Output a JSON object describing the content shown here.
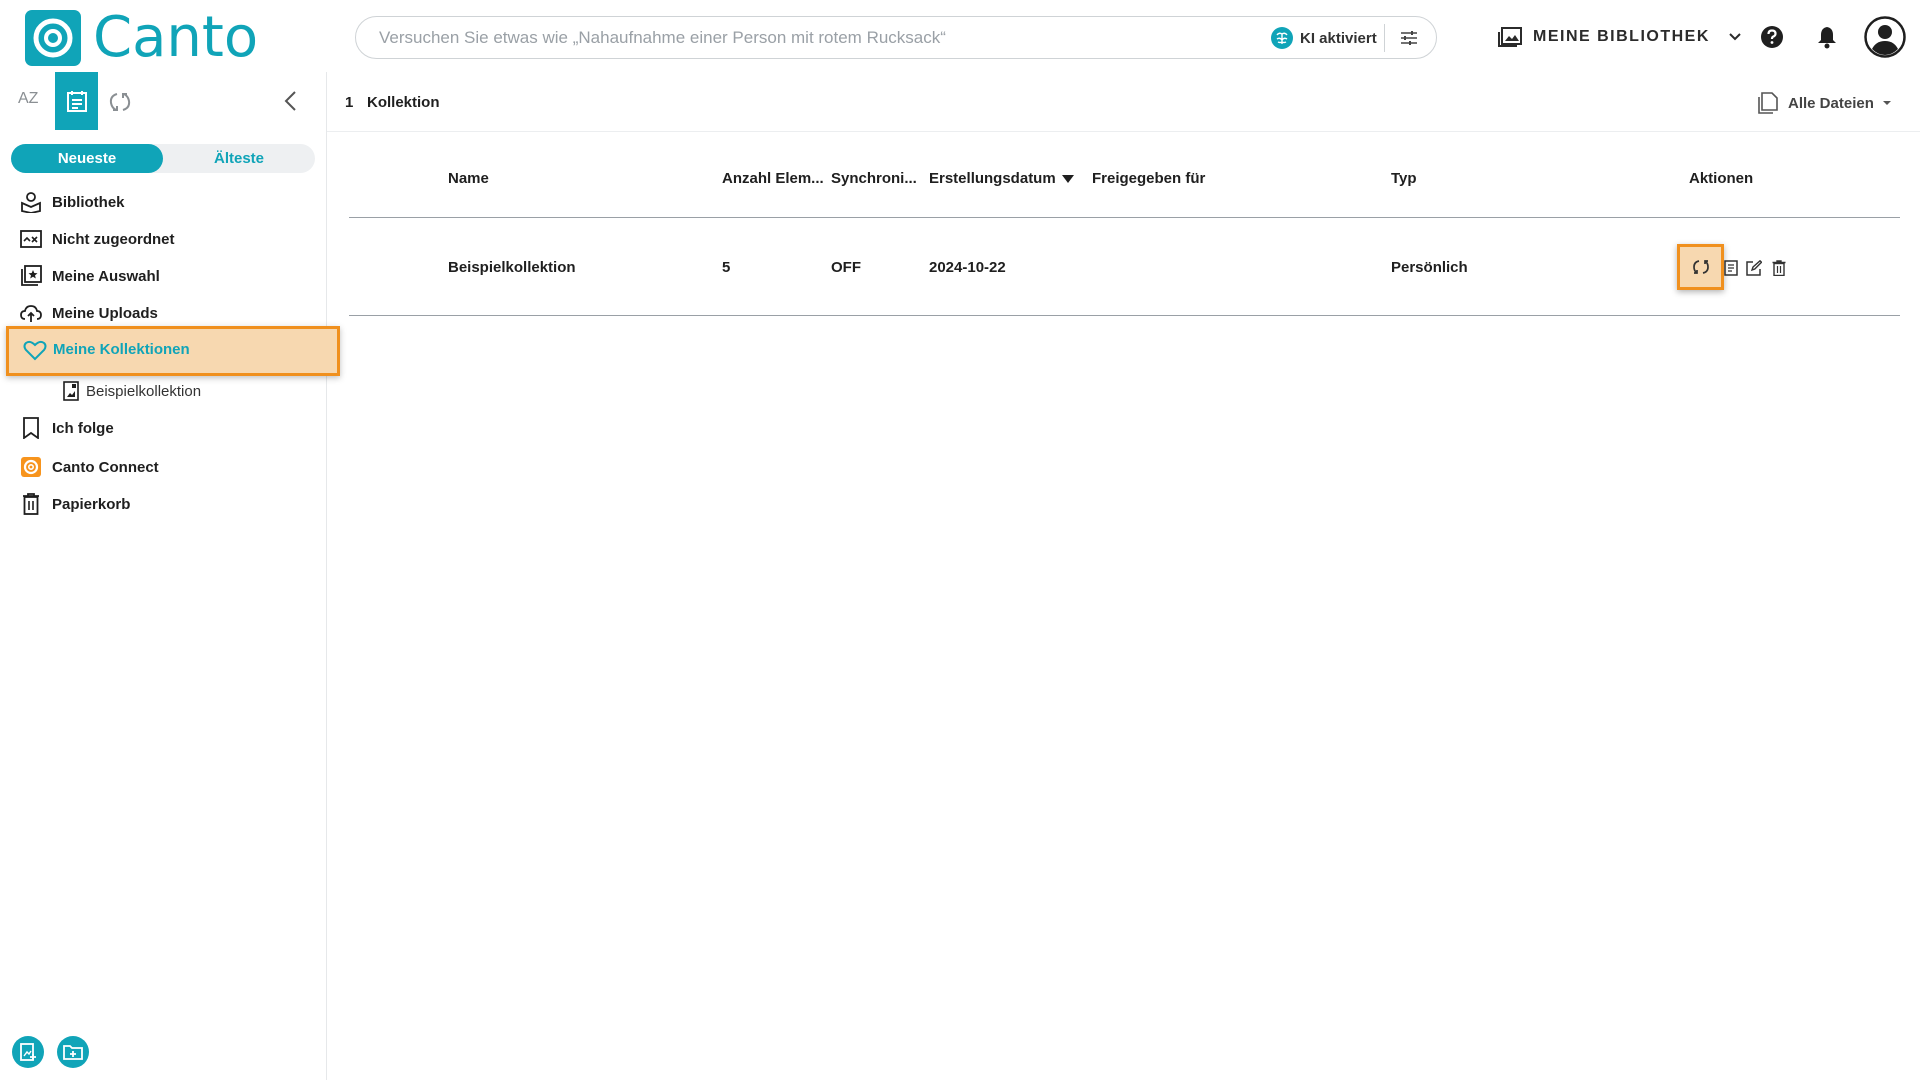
{
  "header": {
    "logo_text": "Canto",
    "search_placeholder": "Versuchen Sie etwas wie „Nahaufnahme einer Person mit rotem Rucksack“",
    "ai_label": "KI aktiviert",
    "library_label": "MEINE BIBLIOTHEK",
    "icons": [
      "brain-icon",
      "filter-sliders-icon",
      "library-icon",
      "chevron-down-icon",
      "help-icon",
      "bell-icon",
      "user-avatar-icon"
    ]
  },
  "sidebar": {
    "tab_az": "AZ",
    "sort": {
      "newest": "Neueste",
      "oldest": "Älteste"
    },
    "items": [
      {
        "label": "Bibliothek",
        "icon": "library-person-icon"
      },
      {
        "label": "Nicht zugeordnet",
        "icon": "unassigned-icon"
      },
      {
        "label": "Meine Auswahl",
        "icon": "selection-star-icon"
      },
      {
        "label": "Meine Uploads",
        "icon": "upload-icon"
      },
      {
        "label": "Meine Kollektionen",
        "icon": "heart-icon",
        "active": true
      },
      {
        "label": "Ich folge",
        "icon": "bookmark-icon"
      },
      {
        "label": "Canto Connect",
        "icon": "canto-connect-icon"
      },
      {
        "label": "Papierkorb",
        "icon": "trash-icon"
      }
    ],
    "sub_items": [
      {
        "label": "Beispielkollektion",
        "icon": "collection-icon"
      }
    ]
  },
  "main": {
    "count": "1",
    "count_label": "Kollektion",
    "all_files_label": "Alle Dateien",
    "columns": [
      "Name",
      "Anzahl Elem...",
      "Synchroni...",
      "Erstellungsdatum",
      "Freigegeben für",
      "Typ",
      "Aktionen"
    ],
    "rows": [
      {
        "name": "Beispielkollektion",
        "count": "5",
        "sync": "OFF",
        "date": "2024-10-22",
        "shared": "",
        "type": "Persönlich"
      }
    ]
  },
  "colors": {
    "accent": "#10a4b8",
    "highlight_bg": "#f7d8b0",
    "highlight_border": "#f0901e",
    "canto_connect": "#f7941d"
  }
}
